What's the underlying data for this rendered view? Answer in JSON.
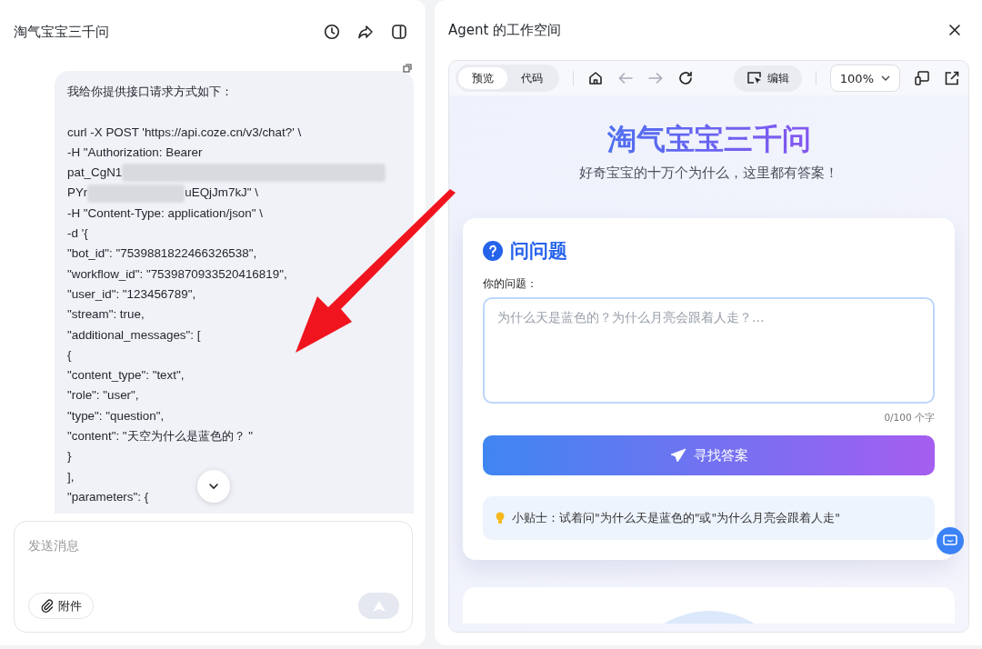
{
  "chat": {
    "title": "淘气宝宝三千问",
    "message": [
      {
        "kind": "text",
        "text": "我给你提供接口请求方式如下："
      },
      {
        "kind": "blank"
      },
      {
        "kind": "text",
        "text": "curl -X POST 'https://api.coze.cn/v3/chat?' \\"
      },
      {
        "kind": "text",
        "text": "-H \"Authorization: Bearer"
      },
      {
        "kind": "redacted",
        "before": "pat_CgN1"
      },
      {
        "kind": "redacted",
        "before": "PYr",
        "after": "uEQjJm7kJ\" \\"
      },
      {
        "kind": "text",
        "text": "-H \"Content-Type: application/json\" \\"
      },
      {
        "kind": "text",
        "text": "-d '{"
      },
      {
        "kind": "text",
        "text": "\"bot_id\": \"7539881822466326538\","
      },
      {
        "kind": "text",
        "text": "\"workflow_id\": \"7539870933520416819\","
      },
      {
        "kind": "text",
        "text": "\"user_id\": \"123456789\","
      },
      {
        "kind": "text",
        "text": "\"stream\": true,"
      },
      {
        "kind": "text",
        "text": "\"additional_messages\": ["
      },
      {
        "kind": "text",
        "text": "{"
      },
      {
        "kind": "text",
        "text": "\"content_type\": \"text\","
      },
      {
        "kind": "text",
        "text": "\"role\": \"user\","
      },
      {
        "kind": "text",
        "text": "\"type\": \"question\","
      },
      {
        "kind": "text",
        "text": "\"content\": \"天空为什么是蓝色的？ \""
      },
      {
        "kind": "text",
        "text": "}"
      },
      {
        "kind": "text",
        "text": "],"
      },
      {
        "kind": "text",
        "text": "\"parameters\": {"
      }
    ],
    "input": {
      "placeholder": "发送消息"
    },
    "attach_button": "附件",
    "send_disabled": true
  },
  "workspace": {
    "title": "Agent 的工作空间",
    "tabs": [
      {
        "label": "预览",
        "selected": true
      },
      {
        "label": "代码",
        "selected": false
      }
    ],
    "nav": [
      {
        "kind": "home",
        "disabled": false
      },
      {
        "kind": "back",
        "disabled": true
      },
      {
        "kind": "forward",
        "disabled": true
      },
      {
        "kind": "refresh",
        "disabled": false
      }
    ],
    "edit_button": "编辑",
    "zoom": "100%",
    "page": {
      "heading": "淘气宝宝三千问",
      "subheading": "好奇宝宝的十万个为什么，这里都有答案！",
      "card_title": "问问题",
      "field_label": "你的问题：",
      "field_placeholder": "为什么天是蓝色的？为什么月亮会跟着人走？...",
      "counter": "0/100 个字",
      "submit": "寻找答案",
      "tip": "小贴士：试着问\"为什么天是蓝色的\"或\"为什么月亮会跟着人走\""
    }
  }
}
